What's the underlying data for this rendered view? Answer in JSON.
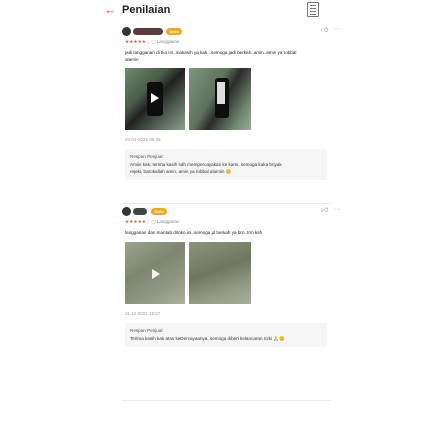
{
  "header": {
    "back_icon": "arrow-left-icon",
    "title": "Penilaian",
    "menu_icon": "document-icon"
  },
  "reviews": [
    {
      "badge": "Gold",
      "stars": "★★★★★",
      "variant_icon": "tag-icon",
      "variant": "Langganan",
      "text": "jadi langganan di tko ini..makasih ya kak...semoga jadi berkah..amin..amin ya robbal alamin",
      "date": "03-01-2022 09:39",
      "reply_title": "Respon Penjual:",
      "reply_text": "Amiin kak, terima kasih sdh mempercayakan ke kami, semoga kaka bnyak rejeki, barokallah amin, amin ya robbal alamiin 😊"
    },
    {
      "badge": "Gold",
      "stars": "★★★★★",
      "variant_icon": "tag-icon",
      "variant": "Langganan",
      "text": "langganan dan mantab ditoko ini..semoga jd berkah ya bro..trm ksh",
      "date": "11-12-2021 19:27",
      "reply_title": "Respon Penjual:",
      "reply_text": "Terima kasih kak atas keDercayaanya, semoga diberi kelancaran rizki 🙏😊"
    }
  ],
  "colors": {
    "accent": "#ee4d2d",
    "badge": "#f2a71b",
    "reply_bg": "#f5f5f5"
  }
}
